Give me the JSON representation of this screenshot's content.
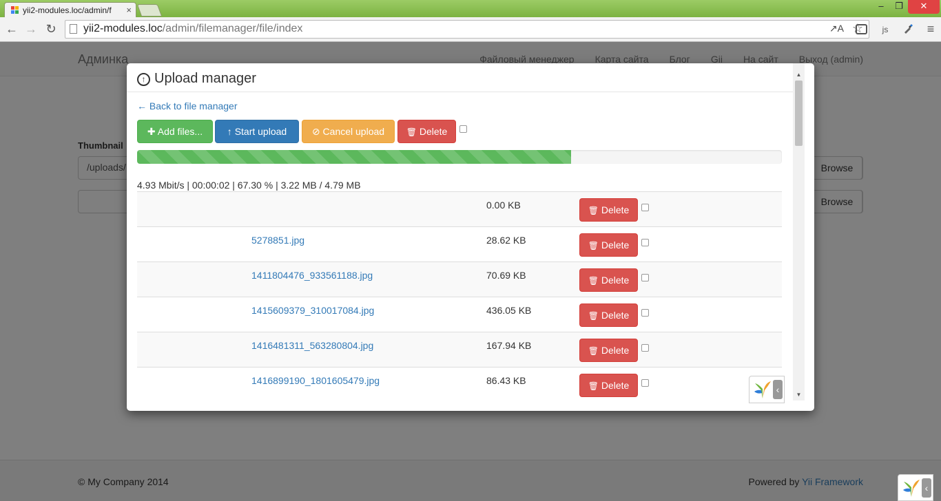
{
  "browser": {
    "tab_title": "yii2-modules.loc/admin/f",
    "close_glyph": "×",
    "url_host": "yii2-modules.loc",
    "url_path": "/admin/filemanager/file/index",
    "translate_glyph": "↗A",
    "min_glyph": "–",
    "max_glyph": "❐",
    "winclose_glyph": "✕",
    "back_glyph": "←",
    "fwd_glyph": "→",
    "reload_glyph": "↻",
    "star_glyph": "☆",
    "ext_js": "js",
    "menu_glyph": "≡"
  },
  "navbar": {
    "brand": "Админка",
    "links": [
      "Файловый менеджер",
      "Карта сайта",
      "Блог",
      "Gii",
      "На сайт",
      "Выход (admin)"
    ]
  },
  "form": {
    "thumbnail_label": "Thumbnail",
    "thumbnail_value": "/uploads/",
    "browse": "Browse"
  },
  "footer": {
    "copyright": "© My Company 2014",
    "powered_prefix": "Powered by ",
    "powered_link": "Yii Framework"
  },
  "modal": {
    "title": "Upload manager",
    "back_link": "← Back to file manager",
    "buttons": {
      "add": "Add files...",
      "start": "Start upload",
      "cancel": "Cancel upload",
      "delete": "Delete"
    },
    "icons": {
      "plus": "✚",
      "upload": "↑",
      "cancel": "⊘",
      "trash": "🗑"
    },
    "progress_percent": 67.3,
    "stats": "4.93 Mbit/s | 00:00:02 | 67.30 % | 3.22 MB / 4.79 MB",
    "files": [
      {
        "name": "",
        "size": "0.00 KB"
      },
      {
        "name": "5278851.jpg",
        "size": "28.62 KB"
      },
      {
        "name": "1411804476_933561188.jpg",
        "size": "70.69 KB"
      },
      {
        "name": "1415609379_310017084.jpg",
        "size": "436.05 KB"
      },
      {
        "name": "1416481311_563280804.jpg",
        "size": "167.94 KB"
      },
      {
        "name": "1416899190_1801605479.jpg",
        "size": "86.43 KB"
      }
    ],
    "scroll_up_glyph": "▲",
    "scroll_down_glyph": "▼"
  },
  "yii_toolbar": {
    "collapse_glyph": "‹"
  },
  "colors": {
    "success": "#5cb85c",
    "primary": "#337ab7",
    "warning": "#f0ad4e",
    "danger": "#d9534f",
    "tabbar": "#8bc34a"
  }
}
